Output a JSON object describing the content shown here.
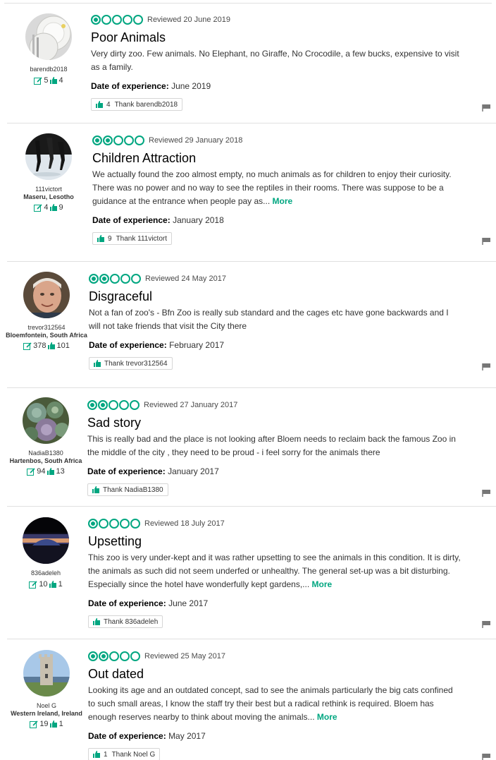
{
  "reviews": [
    {
      "username": "barendb2018",
      "location": "",
      "contributions": "5",
      "helpful_votes": "4",
      "rating": 1,
      "date": "Reviewed 20 June 2019",
      "title": "Poor Animals",
      "text": "Very dirty zoo. Few animals. No Elephant, no Giraffe, No Crocodile, a few bucks, expensive to visit as a family.",
      "more": "",
      "experience_label": "Date of experience:",
      "experience": "June 2019",
      "thank_count": "4",
      "thank_label": "Thank barendb2018",
      "avatar": "plates-icon"
    },
    {
      "username": "111victort",
      "location": "Maseru, Lesotho",
      "contributions": "4",
      "helpful_votes": "9",
      "rating": 2,
      "date": "Reviewed 29 January 2018",
      "title": "Children Attraction",
      "text": "We actually found the zoo almost empty, no much animals as for children to enjoy their curiosity. There was no power and no way to see the reptiles in their rooms. There was suppose to be a guidance at the entrance when people pay as...",
      "more": "More",
      "experience_label": "Date of experience:",
      "experience": "January 2018",
      "thank_count": "9",
      "thank_label": "Thank 111victort",
      "avatar": "walking-people-icon"
    },
    {
      "username": "trevor312564",
      "location": "Bloemfontein, South Africa",
      "contributions": "378",
      "helpful_votes": "101",
      "rating": 2,
      "date": "Reviewed 24 May 2017",
      "title": "Disgraceful",
      "text": "Not a fan of zoo's - Bfn Zoo is really sub standard and the cages etc have gone backwards and I will not take friends that visit the City there",
      "more": "",
      "experience_label": "Date of experience:",
      "experience": "February 2017",
      "thank_count": "",
      "thank_label": "Thank trevor312564",
      "avatar": "man-portrait-icon"
    },
    {
      "username": "NadiaB1380",
      "location": "Hartenbos, South Africa",
      "contributions": "94",
      "helpful_votes": "13",
      "rating": 2,
      "date": "Reviewed 27 January 2017",
      "title": "Sad story",
      "text": "This is really bad and the place is not looking after Bloem needs to reclaim back the famous Zoo in the middle of the city , they need to be proud - i feel sorry for the animals there",
      "more": "",
      "experience_label": "Date of experience:",
      "experience": "January 2017",
      "thank_count": "",
      "thank_label": "Thank NadiaB1380",
      "avatar": "succulents-icon"
    },
    {
      "username": "836adeleh",
      "location": "",
      "contributions": "10",
      "helpful_votes": "1",
      "rating": 1,
      "date": "Reviewed 18 July 2017",
      "title": "Upsetting",
      "text": "This zoo is very under-kept and it was rather upsetting to see the animals in this condition. It is dirty, the animals as such did not seem underfed or unhealthy. The general set-up was a bit disturbing. Especially since the hotel have wonderfully kept gardens,...",
      "more": "More",
      "experience_label": "Date of experience:",
      "experience": "June 2017",
      "thank_count": "",
      "thank_label": "Thank 836adeleh",
      "avatar": "sunset-icon"
    },
    {
      "username": "Noel G",
      "location": "Western Ireland, Ireland",
      "contributions": "19",
      "helpful_votes": "1",
      "rating": 2,
      "date": "Reviewed 25 May 2017",
      "title": "Out dated",
      "text": "Looking its age and an outdated concept, sad to see the animals particularly the big cats confined to such small areas, I know the staff try their best but a radical rethink is required. Bloem has enough reserves nearby to think about moving the animals...",
      "more": "More",
      "experience_label": "Date of experience:",
      "experience": "May 2017",
      "thank_count": "1",
      "thank_label": "Thank Noel G",
      "avatar": "castle-tower-icon"
    }
  ],
  "colors": {
    "accent": "#00a680",
    "text": "#333333",
    "divider": "#e0e0e0"
  }
}
